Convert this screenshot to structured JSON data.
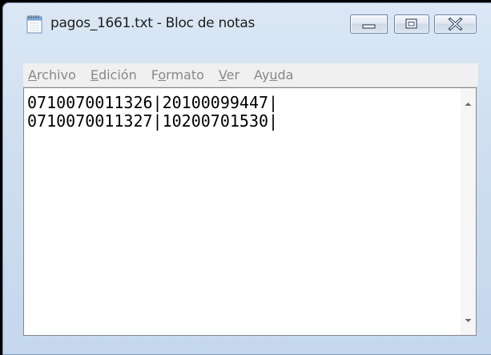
{
  "window": {
    "title": "pagos_1661.txt - Bloc de notas"
  },
  "menu": {
    "items": [
      {
        "pre": "",
        "u": "A",
        "post": "rchivo"
      },
      {
        "pre": "",
        "u": "E",
        "post": "dición"
      },
      {
        "pre": "F",
        "u": "o",
        "post": "rmato"
      },
      {
        "pre": "",
        "u": "V",
        "post": "er"
      },
      {
        "pre": "Ay",
        "u": "u",
        "post": "da"
      }
    ]
  },
  "editor": {
    "lines": [
      "0710070011326|20100099447|",
      "0710070011327|10200701530|"
    ]
  },
  "icons": {
    "app": "notepad-icon",
    "minimize": "minimize-icon",
    "maximize": "maximize-icon",
    "close": "close-icon"
  }
}
